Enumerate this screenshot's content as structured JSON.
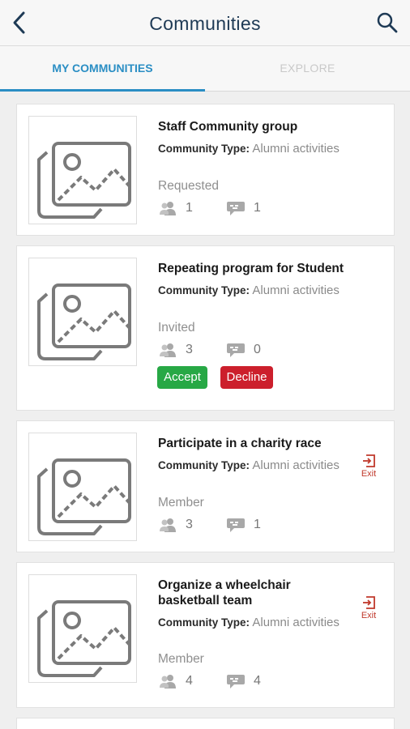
{
  "header": {
    "title": "Communities",
    "back_icon": "chevron-left-icon",
    "search_icon": "search-icon"
  },
  "tabs": [
    {
      "label": "MY COMMUNITIES",
      "active": true
    },
    {
      "label": "EXPLORE",
      "active": false
    }
  ],
  "type_label": "Community Type:",
  "communities": [
    {
      "name": "Staff Community group",
      "type": "Alumni activities",
      "status": "Requested",
      "members": "1",
      "messages": "1"
    },
    {
      "name": "Repeating program for Student",
      "type": "Alumni activities",
      "status": "Invited",
      "members": "3",
      "messages": "0",
      "accept_label": "Accept",
      "decline_label": "Decline"
    },
    {
      "name": "Participate in a charity race",
      "type": "Alumni activities",
      "status": "Member",
      "members": "3",
      "messages": "1",
      "exit_label": "Exit"
    },
    {
      "name": "Organize a wheelchair basketball team",
      "type": "Alumni activities",
      "status": "Member",
      "members": "4",
      "messages": "4",
      "exit_label": "Exit"
    }
  ],
  "colors": {
    "accent": "#2a8ec4",
    "accept": "#27a845",
    "decline": "#cc1f2c",
    "exit": "#c0392b"
  }
}
